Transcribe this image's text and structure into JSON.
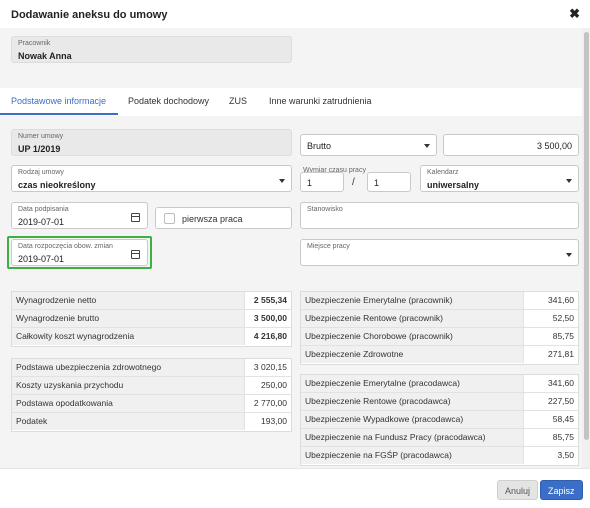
{
  "dialog": {
    "title": "Dodawanie aneksu do umowy",
    "close_label": "✖"
  },
  "employee": {
    "label": "Pracownik",
    "value": "Nowak Anna"
  },
  "tabs": [
    {
      "label": "Podstawowe informacje",
      "active": true
    },
    {
      "label": "Podatek dochodowy",
      "active": false
    },
    {
      "label": "ZUS",
      "active": false
    },
    {
      "label": "Inne warunki zatrudnienia",
      "active": false
    }
  ],
  "form": {
    "contract_number": {
      "label": "Numer umowy",
      "value": "UP 1/2019"
    },
    "salary_type": {
      "value": "Brutto"
    },
    "salary_amount": {
      "value": "3 500,00"
    },
    "contract_type": {
      "label": "Rodzaj umowy",
      "value": "czas nieokreślony"
    },
    "working_time": {
      "label": "Wymiar czasu pracy",
      "numerator": "1",
      "denominator": "1",
      "separator": "/"
    },
    "calendar": {
      "label": "Kalendarz",
      "value": "uniwersalny"
    },
    "signing_date": {
      "label": "Data podpisania",
      "value": "2019-07-01"
    },
    "first_job": {
      "label": "pierwsza praca",
      "checked": false
    },
    "position": {
      "label": "Stanowisko",
      "value": ""
    },
    "start_date": {
      "label": "Data rozpoczęcia obow. zmian",
      "value": "2019-07-01"
    },
    "workplace": {
      "label": "Miejsce pracy",
      "value": ""
    }
  },
  "summary_left_top": [
    {
      "label": "Wynagrodzenie netto",
      "value": "2 555,34",
      "bold": true
    },
    {
      "label": "Wynagrodzenie brutto",
      "value": "3 500,00",
      "bold": true
    },
    {
      "label": "Całkowity koszt wynagrodzenia",
      "value": "4 216,80",
      "bold": true
    }
  ],
  "summary_left_bottom": [
    {
      "label": "Podstawa ubezpieczenia zdrowotnego",
      "value": "3 020,15"
    },
    {
      "label": "Koszty uzyskania przychodu",
      "value": "250,00"
    },
    {
      "label": "Podstawa opodatkowania",
      "value": "2 770,00"
    },
    {
      "label": "Podatek",
      "value": "193,00"
    }
  ],
  "summary_right_top": [
    {
      "label": "Ubezpieczenie Emerytalne (pracownik)",
      "value": "341,60"
    },
    {
      "label": "Ubezpieczenie Rentowe (pracownik)",
      "value": "52,50"
    },
    {
      "label": "Ubezpieczenie Chorobowe (pracownik)",
      "value": "85,75"
    },
    {
      "label": "Ubezpieczenie Zdrowotne",
      "value": "271,81"
    }
  ],
  "summary_right_bottom": [
    {
      "label": "Ubezpieczenie Emerytalne (pracodawca)",
      "value": "341,60"
    },
    {
      "label": "Ubezpieczenie Rentowe (pracodawca)",
      "value": "227,50"
    },
    {
      "label": "Ubezpieczenie Wypadkowe (pracodawca)",
      "value": "58,45"
    },
    {
      "label": "Ubezpieczenie na Fundusz Pracy (pracodawca)",
      "value": "85,75"
    },
    {
      "label": "Ubezpieczenie na FGŚP (pracodawca)",
      "value": "3,50"
    }
  ],
  "footer": {
    "cancel_label": "Anuluj",
    "save_label": "Zapisz"
  },
  "colors": {
    "accent": "#3a6ec7",
    "highlight_border": "#3cb043"
  }
}
